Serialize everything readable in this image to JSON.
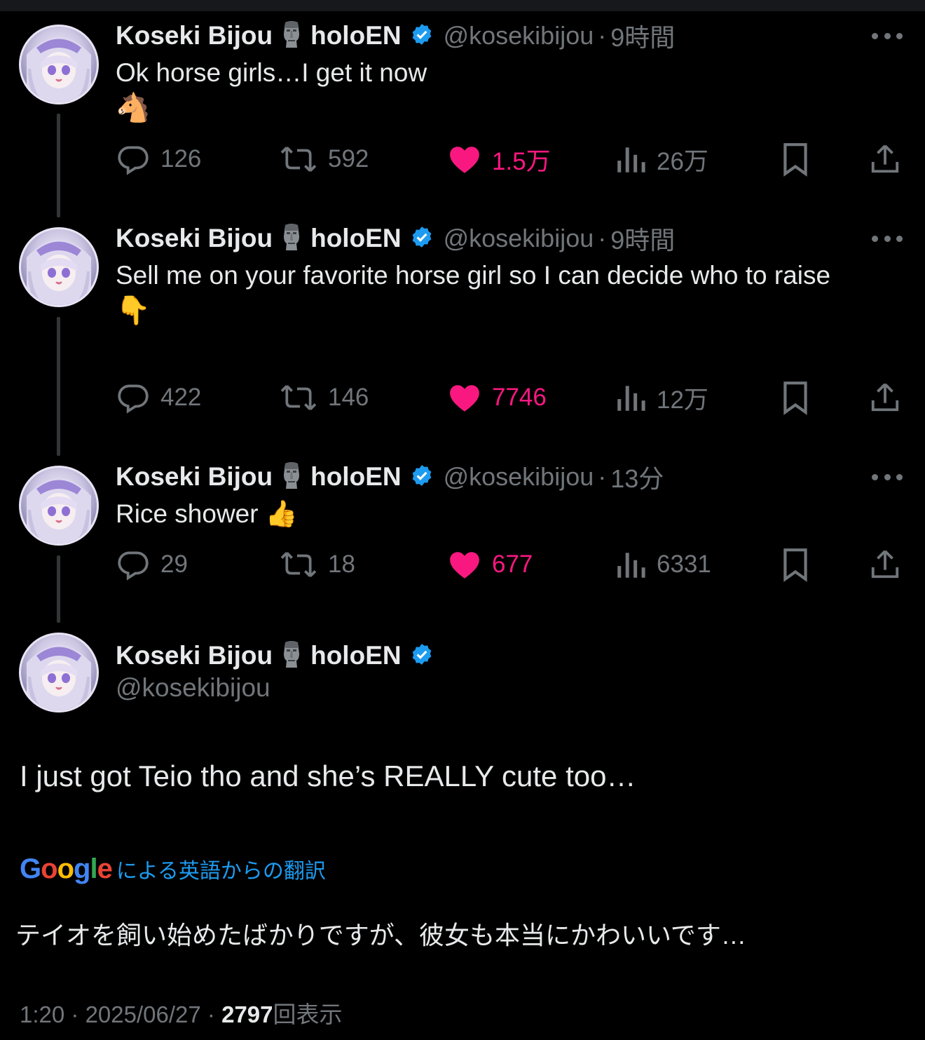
{
  "tweets": [
    {
      "name": "Koseki Bijou",
      "org": "holoEN",
      "handle": "@kosekibijou",
      "time": "9時間",
      "text": "Ok horse girls…I get it now",
      "emoji": "🐴",
      "stats": {
        "replies": "126",
        "reposts": "592",
        "likes": "1.5万",
        "views": "26万"
      }
    },
    {
      "name": "Koseki Bijou",
      "org": "holoEN",
      "handle": "@kosekibijou",
      "time": "9時間",
      "text": "Sell me on your favorite horse girl so I can decide who to raise",
      "emoji": "👇",
      "stats": {
        "replies": "422",
        "reposts": "146",
        "likes": "7746",
        "views": "12万"
      }
    },
    {
      "name": "Koseki Bijou",
      "org": "holoEN",
      "handle": "@kosekibijou",
      "time": "13分",
      "text": "Rice shower 👍",
      "stats": {
        "replies": "29",
        "reposts": "18",
        "likes": "677",
        "views": "6331"
      }
    }
  ],
  "main_tweet": {
    "name": "Koseki Bijou",
    "org": "holoEN",
    "handle": "@kosekibijou",
    "text": "I just got Teio tho and she’s REALLY cute too…",
    "translation_provider": "Google",
    "translation_label": "による英語からの翻訳",
    "translated_text": "テイオを飼い始めたばかりですが、彼女も本当にかわいいです…",
    "time": "1:20",
    "date": "2025/06/27",
    "views_count": "2797",
    "views_label": "回表示",
    "separator": "·"
  },
  "colors": {
    "background": "#000000",
    "text": "#e7e9ea",
    "muted": "#71767b",
    "like": "#f91880",
    "link": "#1d9bf0",
    "verified": "#1d9bf0"
  },
  "icons": [
    "reply-icon",
    "repost-icon",
    "heart-icon",
    "views-icon",
    "bookmark-icon",
    "share-icon",
    "more-icon",
    "verified-icon",
    "moai-icon"
  ]
}
